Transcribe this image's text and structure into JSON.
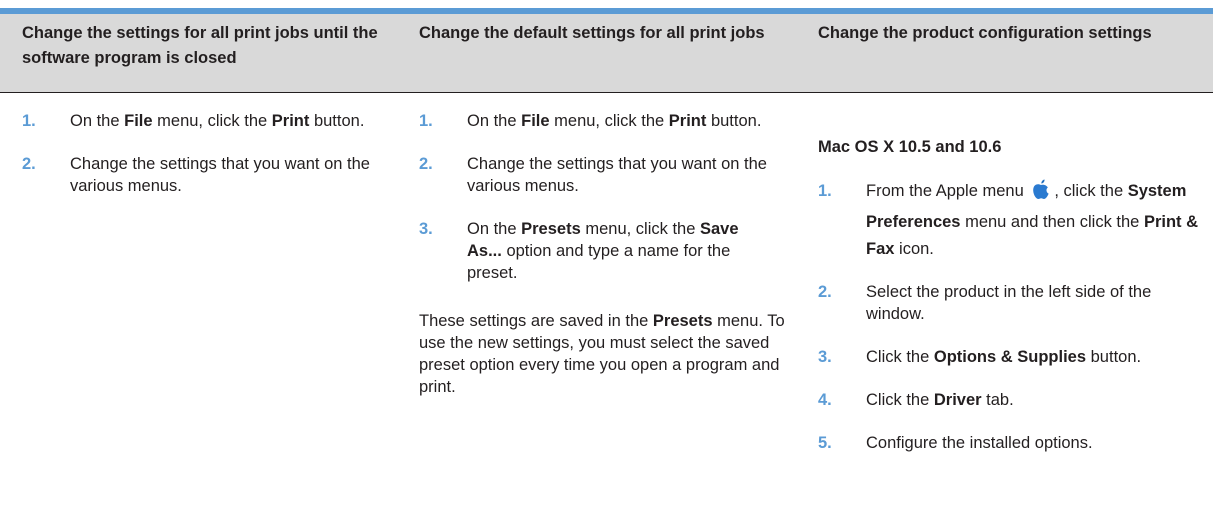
{
  "headers": [
    "Change the settings for all print jobs until the software program is closed",
    "Change the default settings for all print jobs",
    "Change the product configuration settings"
  ],
  "col1": {
    "steps": [
      {
        "num": "1.",
        "a": "On the ",
        "b1": "File",
        "c": " menu, click the ",
        "b2": "Print",
        "d": " button."
      },
      {
        "num": "2.",
        "text": "Change the settings that you want on the various menus."
      }
    ]
  },
  "col2": {
    "steps": [
      {
        "num": "1.",
        "a": "On the ",
        "b1": "File",
        "c": " menu, click the ",
        "b2": "Print",
        "d": " button."
      },
      {
        "num": "2.",
        "text": "Change the settings that you want on the various menus."
      },
      {
        "num": "3.",
        "a": "On the ",
        "b1": "Presets",
        "c": " menu, click the ",
        "b2": "Save As...",
        "d": " option and type a name for the preset."
      }
    ],
    "note": {
      "a": "These settings are saved in the ",
      "b": "Presets",
      "c": " menu. To use the new settings, you must select the saved preset option every time you open a program and print."
    }
  },
  "col3": {
    "subhead": "Mac OS X 10.5 and 10.6",
    "steps": [
      {
        "num": "1.",
        "a": "From the Apple menu ",
        "c": ", click the ",
        "b1": "System Preferences",
        "d": " menu and then click the ",
        "b2": "Print & Fax",
        "e": " icon."
      },
      {
        "num": "2.",
        "text": "Select the product in the left side of the window."
      },
      {
        "num": "3.",
        "a": "Click the ",
        "b1": "Options & Supplies",
        "d": " button."
      },
      {
        "num": "4.",
        "a": "Click the ",
        "b1": "Driver",
        "d": " tab."
      },
      {
        "num": "5.",
        "text": "Configure the installed options."
      }
    ]
  },
  "icons": {
    "apple": "apple-icon"
  },
  "colors": {
    "accent": "#5b9bd5",
    "header_bg": "#d9d9d9"
  }
}
